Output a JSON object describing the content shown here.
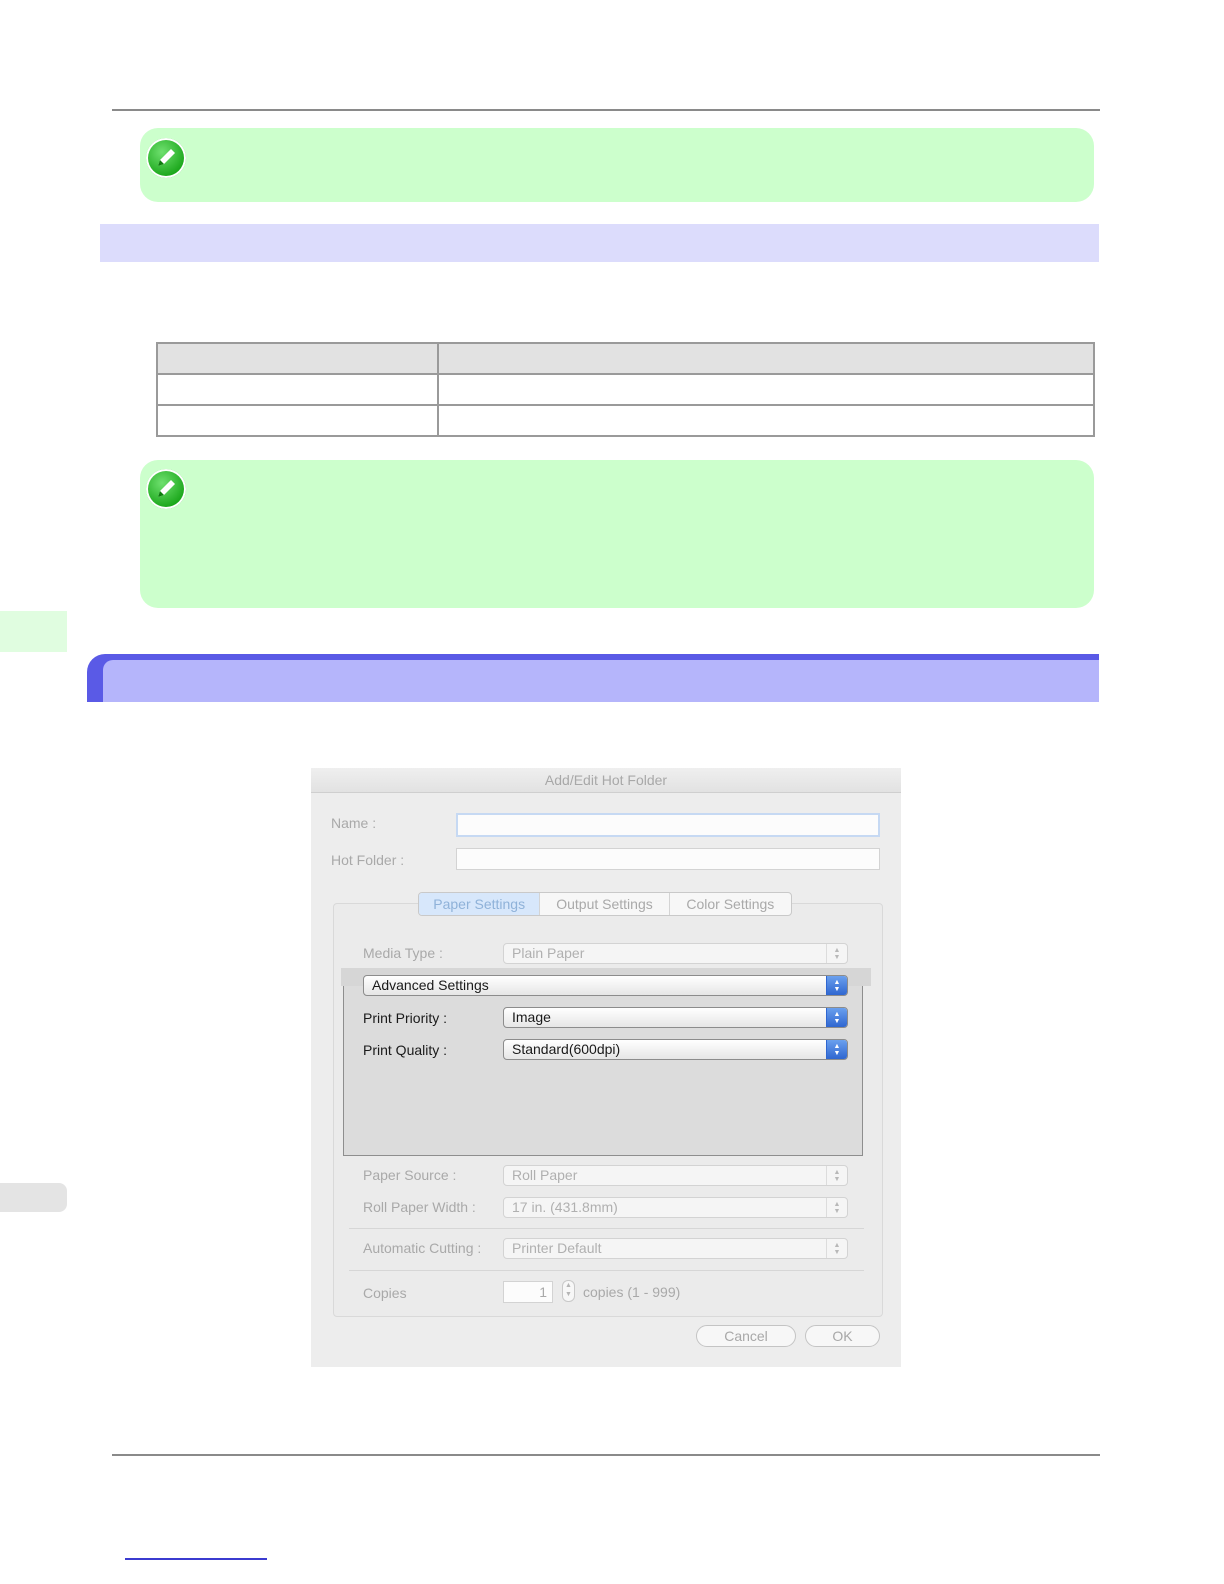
{
  "dialog": {
    "title": "Add/Edit Hot Folder",
    "name_label": "Name :",
    "name_value": "",
    "hot_folder_label": "Hot Folder :",
    "hot_folder_value": "",
    "tabs": [
      {
        "label": "Paper Settings",
        "active": true
      },
      {
        "label": "Output Settings",
        "active": false
      },
      {
        "label": "Color Settings",
        "active": false
      }
    ],
    "media_type": {
      "label": "Media Type :",
      "value": "Plain Paper"
    },
    "advanced": {
      "value": "Advanced Settings"
    },
    "print_priority": {
      "label": "Print Priority :",
      "value": "Image"
    },
    "print_quality": {
      "label": "Print Quality :",
      "value": "Standard(600dpi)"
    },
    "paper_source": {
      "label": "Paper Source :",
      "value": "Roll Paper"
    },
    "roll_paper_width": {
      "label": "Roll Paper Width :",
      "value": "17 in. (431.8mm)"
    },
    "automatic_cutting": {
      "label": "Automatic Cutting :",
      "value": "Printer Default"
    },
    "copies": {
      "label": "Copies",
      "value": "1",
      "suffix": "copies (1 - 999)"
    },
    "cancel_label": "Cancel",
    "ok_label": "OK"
  },
  "colors": {
    "note_background": "#ccffcc",
    "section_bar": "#dcdcfc",
    "chapter_bar": "#5a5ae6",
    "focus_ring": "#c6d9f3"
  }
}
